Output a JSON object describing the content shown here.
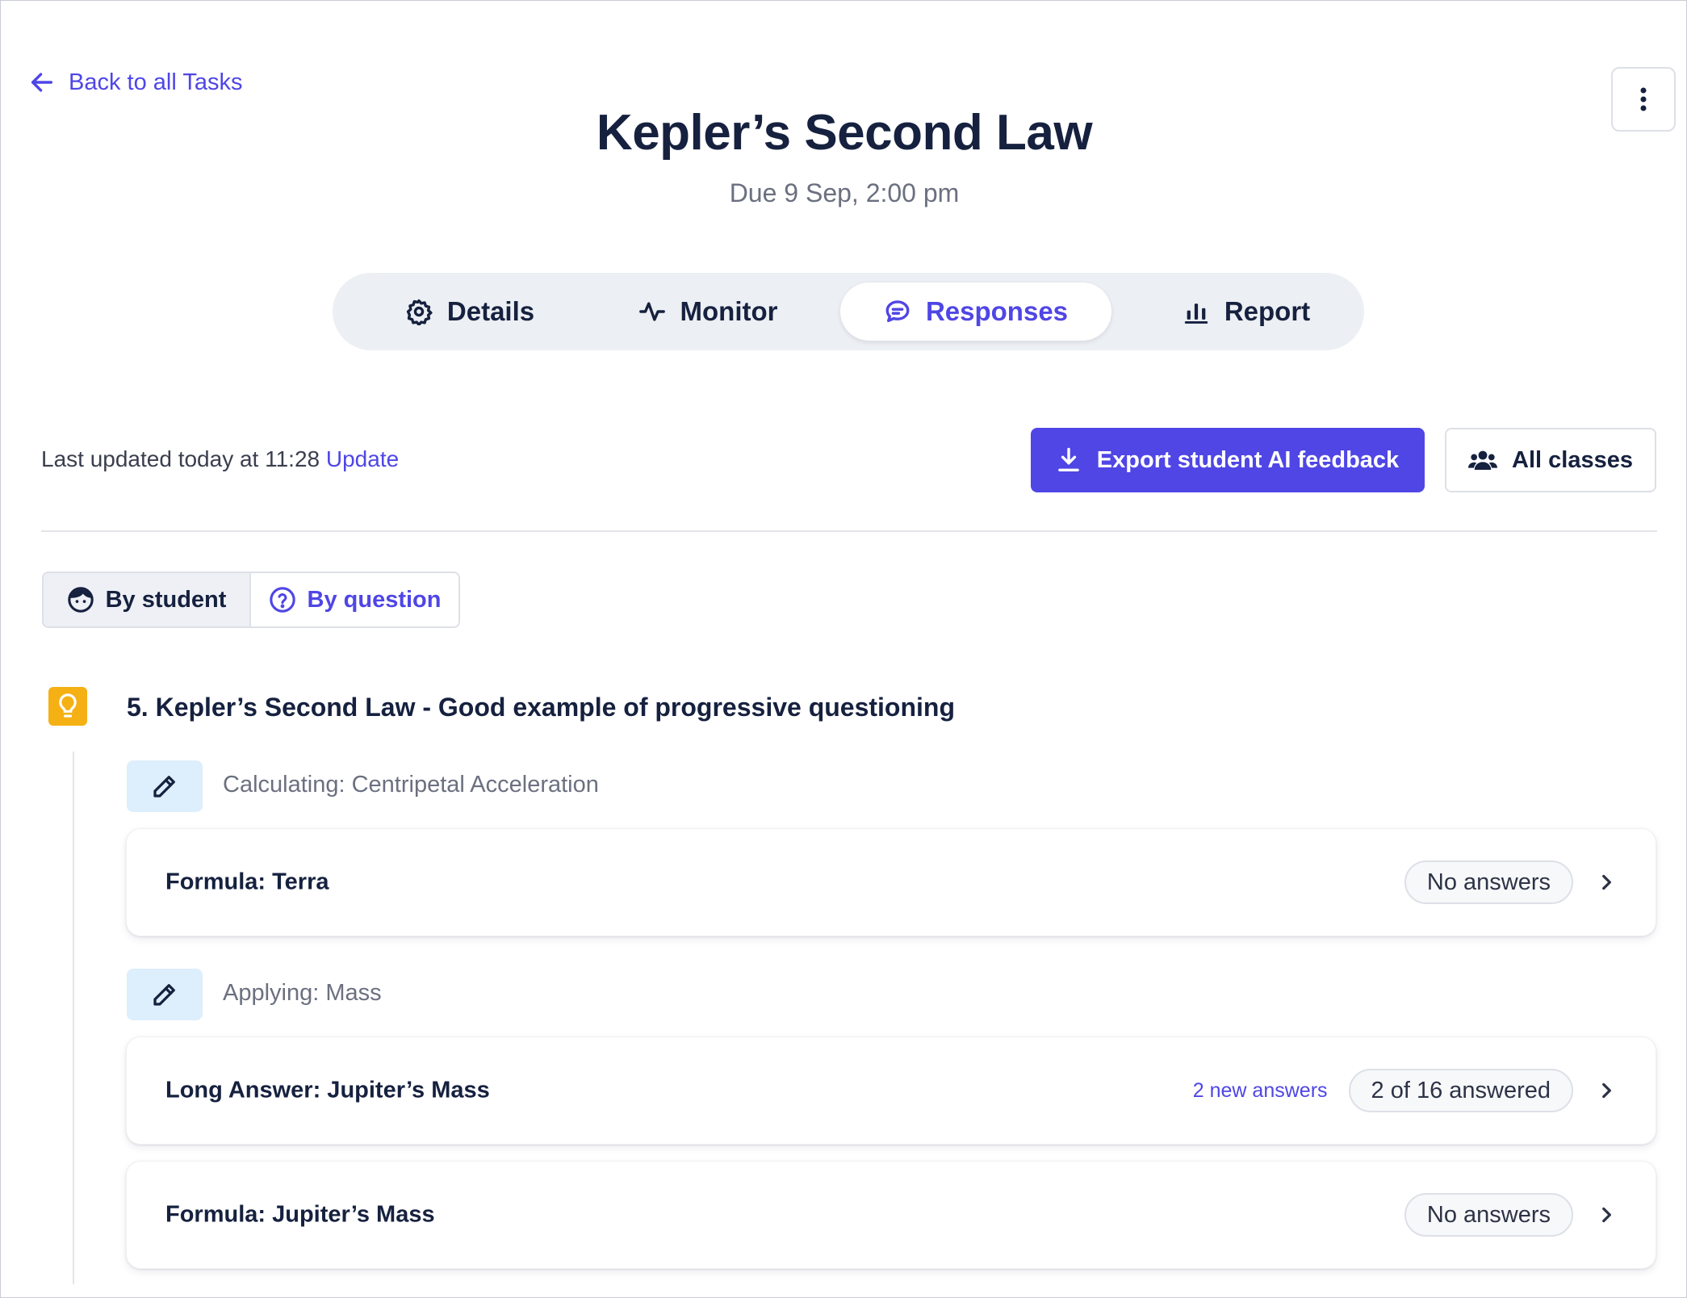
{
  "nav": {
    "back_label": "Back to all Tasks"
  },
  "header": {
    "title": "Kepler’s Second Law",
    "due": "Due 9 Sep, 2:00 pm"
  },
  "tabs": [
    {
      "label": "Details",
      "icon": "gear-icon",
      "active": false
    },
    {
      "label": "Monitor",
      "icon": "activity-icon",
      "active": false
    },
    {
      "label": "Responses",
      "icon": "chat-icon",
      "active": true
    },
    {
      "label": "Report",
      "icon": "bar-chart-icon",
      "active": false
    }
  ],
  "toolbar": {
    "last_updated": "Last updated today at 11:28",
    "update_link": "Update",
    "export_label": "Export student AI feedback",
    "classes_label": "All classes"
  },
  "view_toggle": {
    "by_student": "By student",
    "by_question": "By question",
    "selected": "By student"
  },
  "section": {
    "title": "5. Kepler’s Second Law - Good example of progressive questioning",
    "icon": "lightbulb-icon",
    "groups": [
      {
        "label": "Calculating: Centripetal Acceleration",
        "icon": "pencil-icon",
        "items": [
          {
            "title": "Formula: Terra",
            "new_answers": "",
            "status": "No answers"
          }
        ]
      },
      {
        "label": "Applying: Mass",
        "icon": "pencil-icon",
        "items": [
          {
            "title": "Long Answer: Jupiter’s Mass",
            "new_answers": "2 new answers",
            "status": "2 of 16 answered"
          },
          {
            "title": "Formula: Jupiter’s Mass",
            "new_answers": "",
            "status": "No answers"
          }
        ]
      }
    ]
  },
  "colors": {
    "accent": "#4f46e5",
    "heading": "#16213f",
    "muted": "#6b7080",
    "lightbulb": "#f5b014",
    "tag_bg": "#ddeefc"
  }
}
